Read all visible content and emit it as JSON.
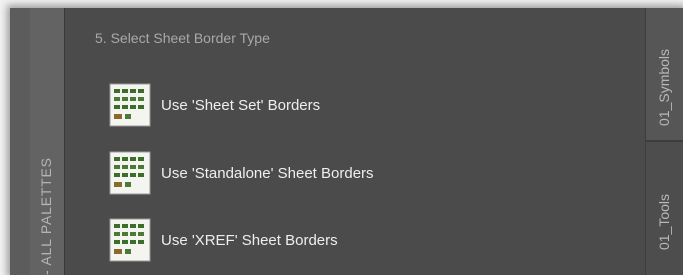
{
  "left_palette": {
    "label": "ALL PALETTES"
  },
  "section": {
    "title": "5. Select Sheet Border Type"
  },
  "items": [
    {
      "label": "Use 'Sheet Set' Borders",
      "icon": "sheet-border-thumbnail-icon"
    },
    {
      "label": "Use 'Standalone' Sheet Borders",
      "icon": "sheet-border-thumbnail-icon"
    },
    {
      "label": "Use 'XREF' Sheet Borders",
      "icon": "sheet-border-thumbnail-icon"
    }
  ],
  "tabs": [
    {
      "label": "01_Symbols"
    },
    {
      "label": "01_Tools"
    }
  ],
  "colors": {
    "panel_bg": "#4b4b4b",
    "strip_bg": "#636363",
    "text_primary": "#eeeeee",
    "text_secondary": "#a9a9a9"
  }
}
